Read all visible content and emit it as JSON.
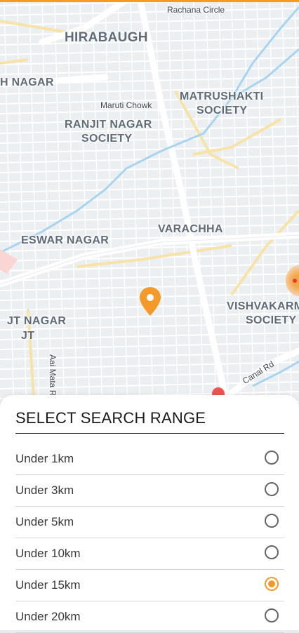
{
  "colors": {
    "accent": "#f39a2b",
    "map_bg": "#eceff1",
    "road": "#ffffff",
    "arterial": "#f7e3a8",
    "water": "#a8d4f0",
    "label": "#5f6b78"
  },
  "map": {
    "labels": {
      "rachana_circle": "Rachana Circle",
      "hirabaugh": "HIRABAUGH",
      "h_nagar": "H NAGAR",
      "maruti_chowk": "Maruti Chowk",
      "ranjit_1": "RANJIT NAGAR",
      "ranjit_2": "SOCIETY",
      "matrushakti_1": "MATRUSHAKTI",
      "matrushakti_2": "SOCIETY",
      "varachha": "VARACHHA",
      "eswar_nagar": "ESWAR NAGAR",
      "vishvakarma_1": "VISHVAKARM",
      "vishvakarma_2": "SOCIETY",
      "jt_nagar_1": "JT NAGAR",
      "jt_nagar_2": "JT",
      "aai_mata": "Aai Mata R",
      "canal_rd": "Canal Rd"
    },
    "pin_icon": "map-pin-icon"
  },
  "sheet": {
    "title": "SELECT SEARCH RANGE",
    "options": [
      {
        "label": "Under 1km",
        "selected": false
      },
      {
        "label": "Under 3km",
        "selected": false
      },
      {
        "label": "Under 5km",
        "selected": false
      },
      {
        "label": "Under 10km",
        "selected": false
      },
      {
        "label": "Under 15km",
        "selected": true
      },
      {
        "label": "Under 20km",
        "selected": false
      }
    ]
  }
}
